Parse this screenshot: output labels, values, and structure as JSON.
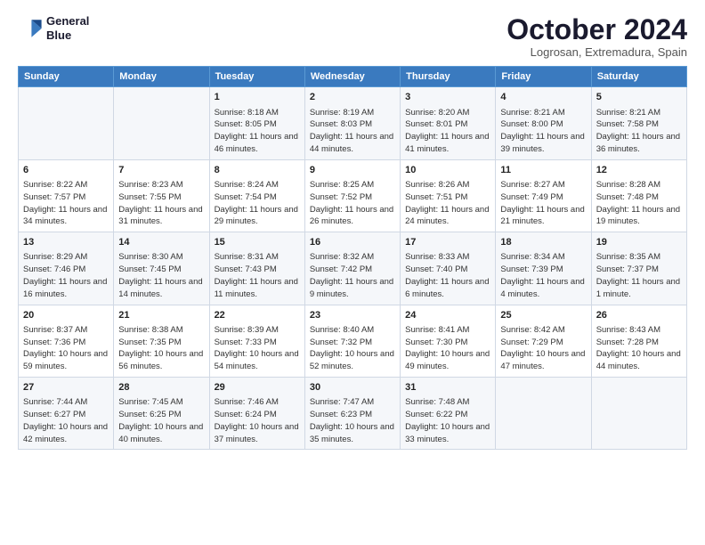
{
  "logo": {
    "line1": "General",
    "line2": "Blue"
  },
  "title": "October 2024",
  "subtitle": "Logrosan, Extremadura, Spain",
  "days_of_week": [
    "Sunday",
    "Monday",
    "Tuesday",
    "Wednesday",
    "Thursday",
    "Friday",
    "Saturday"
  ],
  "weeks": [
    [
      {
        "num": "",
        "detail": ""
      },
      {
        "num": "",
        "detail": ""
      },
      {
        "num": "1",
        "detail": "Sunrise: 8:18 AM\nSunset: 8:05 PM\nDaylight: 11 hours and 46 minutes."
      },
      {
        "num": "2",
        "detail": "Sunrise: 8:19 AM\nSunset: 8:03 PM\nDaylight: 11 hours and 44 minutes."
      },
      {
        "num": "3",
        "detail": "Sunrise: 8:20 AM\nSunset: 8:01 PM\nDaylight: 11 hours and 41 minutes."
      },
      {
        "num": "4",
        "detail": "Sunrise: 8:21 AM\nSunset: 8:00 PM\nDaylight: 11 hours and 39 minutes."
      },
      {
        "num": "5",
        "detail": "Sunrise: 8:21 AM\nSunset: 7:58 PM\nDaylight: 11 hours and 36 minutes."
      }
    ],
    [
      {
        "num": "6",
        "detail": "Sunrise: 8:22 AM\nSunset: 7:57 PM\nDaylight: 11 hours and 34 minutes."
      },
      {
        "num": "7",
        "detail": "Sunrise: 8:23 AM\nSunset: 7:55 PM\nDaylight: 11 hours and 31 minutes."
      },
      {
        "num": "8",
        "detail": "Sunrise: 8:24 AM\nSunset: 7:54 PM\nDaylight: 11 hours and 29 minutes."
      },
      {
        "num": "9",
        "detail": "Sunrise: 8:25 AM\nSunset: 7:52 PM\nDaylight: 11 hours and 26 minutes."
      },
      {
        "num": "10",
        "detail": "Sunrise: 8:26 AM\nSunset: 7:51 PM\nDaylight: 11 hours and 24 minutes."
      },
      {
        "num": "11",
        "detail": "Sunrise: 8:27 AM\nSunset: 7:49 PM\nDaylight: 11 hours and 21 minutes."
      },
      {
        "num": "12",
        "detail": "Sunrise: 8:28 AM\nSunset: 7:48 PM\nDaylight: 11 hours and 19 minutes."
      }
    ],
    [
      {
        "num": "13",
        "detail": "Sunrise: 8:29 AM\nSunset: 7:46 PM\nDaylight: 11 hours and 16 minutes."
      },
      {
        "num": "14",
        "detail": "Sunrise: 8:30 AM\nSunset: 7:45 PM\nDaylight: 11 hours and 14 minutes."
      },
      {
        "num": "15",
        "detail": "Sunrise: 8:31 AM\nSunset: 7:43 PM\nDaylight: 11 hours and 11 minutes."
      },
      {
        "num": "16",
        "detail": "Sunrise: 8:32 AM\nSunset: 7:42 PM\nDaylight: 11 hours and 9 minutes."
      },
      {
        "num": "17",
        "detail": "Sunrise: 8:33 AM\nSunset: 7:40 PM\nDaylight: 11 hours and 6 minutes."
      },
      {
        "num": "18",
        "detail": "Sunrise: 8:34 AM\nSunset: 7:39 PM\nDaylight: 11 hours and 4 minutes."
      },
      {
        "num": "19",
        "detail": "Sunrise: 8:35 AM\nSunset: 7:37 PM\nDaylight: 11 hours and 1 minute."
      }
    ],
    [
      {
        "num": "20",
        "detail": "Sunrise: 8:37 AM\nSunset: 7:36 PM\nDaylight: 10 hours and 59 minutes."
      },
      {
        "num": "21",
        "detail": "Sunrise: 8:38 AM\nSunset: 7:35 PM\nDaylight: 10 hours and 56 minutes."
      },
      {
        "num": "22",
        "detail": "Sunrise: 8:39 AM\nSunset: 7:33 PM\nDaylight: 10 hours and 54 minutes."
      },
      {
        "num": "23",
        "detail": "Sunrise: 8:40 AM\nSunset: 7:32 PM\nDaylight: 10 hours and 52 minutes."
      },
      {
        "num": "24",
        "detail": "Sunrise: 8:41 AM\nSunset: 7:30 PM\nDaylight: 10 hours and 49 minutes."
      },
      {
        "num": "25",
        "detail": "Sunrise: 8:42 AM\nSunset: 7:29 PM\nDaylight: 10 hours and 47 minutes."
      },
      {
        "num": "26",
        "detail": "Sunrise: 8:43 AM\nSunset: 7:28 PM\nDaylight: 10 hours and 44 minutes."
      }
    ],
    [
      {
        "num": "27",
        "detail": "Sunrise: 7:44 AM\nSunset: 6:27 PM\nDaylight: 10 hours and 42 minutes."
      },
      {
        "num": "28",
        "detail": "Sunrise: 7:45 AM\nSunset: 6:25 PM\nDaylight: 10 hours and 40 minutes."
      },
      {
        "num": "29",
        "detail": "Sunrise: 7:46 AM\nSunset: 6:24 PM\nDaylight: 10 hours and 37 minutes."
      },
      {
        "num": "30",
        "detail": "Sunrise: 7:47 AM\nSunset: 6:23 PM\nDaylight: 10 hours and 35 minutes."
      },
      {
        "num": "31",
        "detail": "Sunrise: 7:48 AM\nSunset: 6:22 PM\nDaylight: 10 hours and 33 minutes."
      },
      {
        "num": "",
        "detail": ""
      },
      {
        "num": "",
        "detail": ""
      }
    ]
  ]
}
